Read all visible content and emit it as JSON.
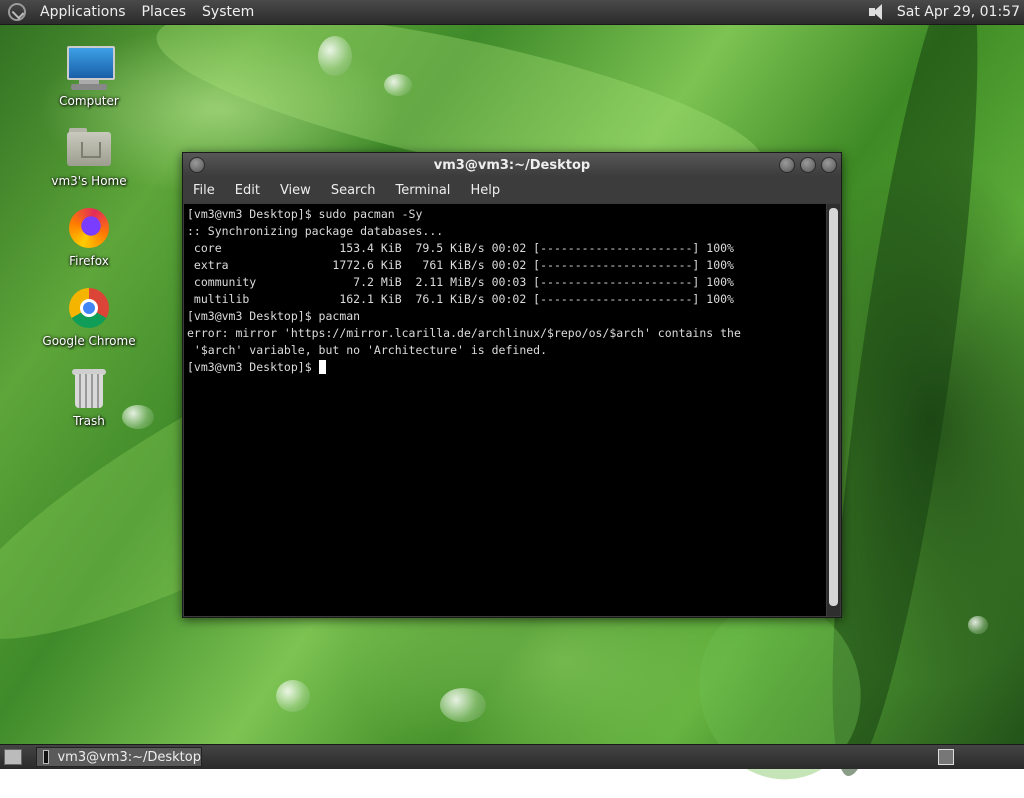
{
  "top_panel": {
    "menus": [
      "Applications",
      "Places",
      "System"
    ],
    "clock": "Sat Apr 29, 01:57"
  },
  "desktop_icons": [
    {
      "label": "Computer",
      "icon": "computer-icon"
    },
    {
      "label": "vm3's Home",
      "icon": "home-folder-icon"
    },
    {
      "label": "Firefox",
      "icon": "firefox-icon"
    },
    {
      "label": "Google Chrome",
      "icon": "chrome-icon"
    },
    {
      "label": "Trash",
      "icon": "trash-icon"
    }
  ],
  "terminal": {
    "title": "vm3@vm3:~/Desktop",
    "menu": [
      "File",
      "Edit",
      "View",
      "Search",
      "Terminal",
      "Help"
    ],
    "lines": [
      "[vm3@vm3 Desktop]$ sudo pacman -Sy",
      ":: Synchronizing package databases...",
      " core                 153.4 KiB  79.5 KiB/s 00:02 [----------------------] 100%",
      " extra               1772.6 KiB   761 KiB/s 00:02 [----------------------] 100%",
      " community              7.2 MiB  2.11 MiB/s 00:03 [----------------------] 100%",
      " multilib             162.1 KiB  76.1 KiB/s 00:02 [----------------------] 100%",
      "[vm3@vm3 Desktop]$ pacman",
      "error: mirror 'https://mirror.lcarilla.de/archlinux/$repo/os/$arch' contains the",
      " '$arch' variable, but no 'Architecture' is defined.",
      "[vm3@vm3 Desktop]$ "
    ]
  },
  "taskbar": {
    "items": [
      {
        "label": "vm3@vm3:~/Desktop"
      }
    ]
  },
  "colors": {
    "panel": "#2b2b2b",
    "terminal_bg": "#000000",
    "terminal_fg": "#dcdcdc"
  }
}
